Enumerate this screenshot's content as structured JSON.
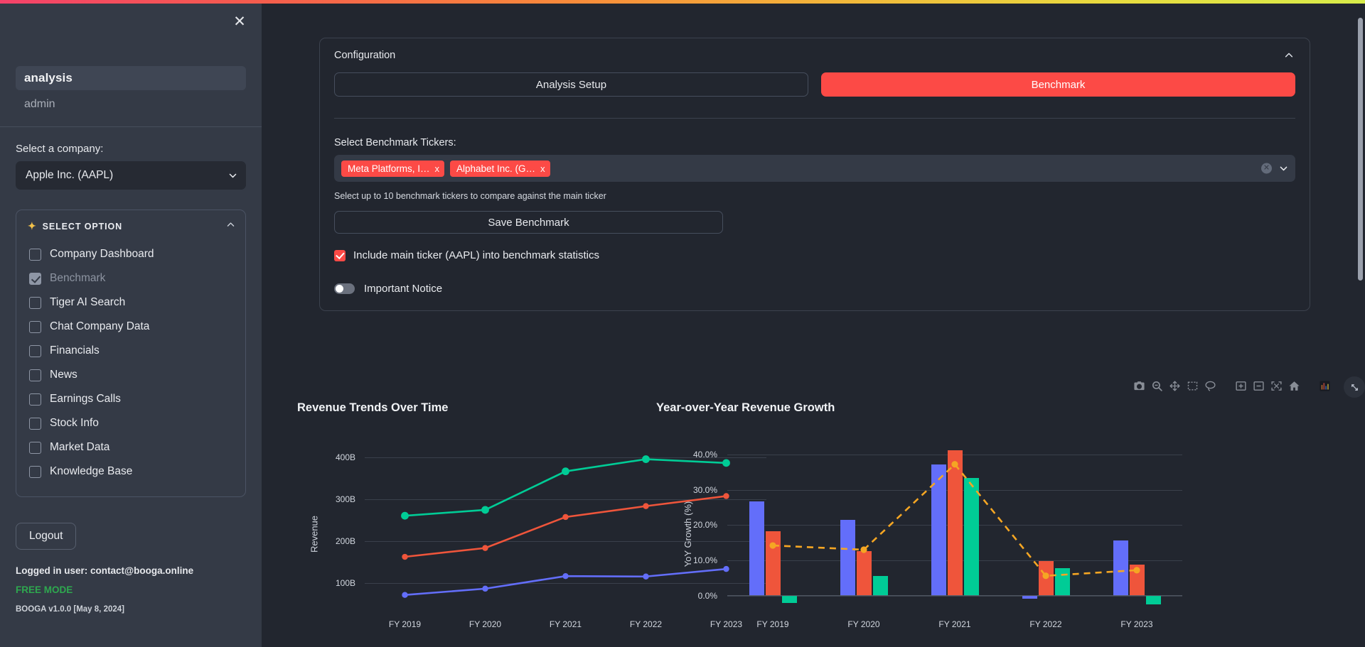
{
  "sidebar": {
    "close_icon": "close-icon",
    "app_name": "analysis",
    "user_role": "admin",
    "company_label": "Select a company:",
    "company_value": "Apple Inc. (AAPL)",
    "options_header": "SELECT OPTION",
    "options_header_icon": "sparkles-icon",
    "options": [
      {
        "label": "Company Dashboard",
        "checked": false,
        "disabled": false
      },
      {
        "label": "Benchmark",
        "checked": true,
        "disabled": true
      },
      {
        "label": "Tiger AI Search",
        "checked": false,
        "disabled": false
      },
      {
        "label": "Chat Company Data",
        "checked": false,
        "disabled": false
      },
      {
        "label": "Financials",
        "checked": false,
        "disabled": false
      },
      {
        "label": "News",
        "checked": false,
        "disabled": false
      },
      {
        "label": "Earnings Calls",
        "checked": false,
        "disabled": false
      },
      {
        "label": "Stock Info",
        "checked": false,
        "disabled": false
      },
      {
        "label": "Market Data",
        "checked": false,
        "disabled": false
      },
      {
        "label": "Knowledge Base",
        "checked": false,
        "disabled": false
      }
    ],
    "logout_label": "Logout",
    "logged_in_user": "Logged in user: contact@booga.online",
    "mode": "FREE MODE",
    "version": "BOOGA v1.0.0 [May 8, 2024]"
  },
  "config": {
    "title": "Configuration",
    "collapse_icon": "chevron-up-icon",
    "tabs": [
      {
        "label": "Analysis Setup",
        "active": false
      },
      {
        "label": "Benchmark",
        "active": true
      }
    ],
    "benchmark_label": "Select Benchmark Tickers:",
    "chips": [
      {
        "label": "Meta Platforms, I…",
        "remove": "x"
      },
      {
        "label": "Alphabet Inc. (G…",
        "remove": "x"
      }
    ],
    "clear_all_icon": "clear-all-icon",
    "dropdown_icon": "chevron-down-icon",
    "help_text": "Select up to 10 benchmark tickers to compare against the main ticker",
    "save_label": "Save Benchmark",
    "include_main_ticker_label": "Include main ticker (AAPL) into benchmark statistics",
    "include_main_ticker_checked": true,
    "notice_label": "Important Notice",
    "notice_on": false
  },
  "modebar": {
    "icons": [
      "camera-icon",
      "zoom-icon",
      "pan-icon",
      "box-select-icon",
      "lasso-select-icon",
      "zoom-in-icon",
      "zoom-out-icon",
      "autoscale-icon",
      "home-reset-icon",
      "plotly-logo-icon"
    ],
    "expand_icon": "expand-fullscreen-icon"
  },
  "colors": {
    "accent_red": "#fc4a46",
    "series_blue": "#636efa",
    "series_red": "#ef553b",
    "series_green": "#00cc96",
    "series_orange": "#f5a623",
    "free_mode_green": "#2ea84f",
    "sidebar_bg": "#343a46",
    "main_bg": "#22262f"
  },
  "chart_data": [
    {
      "type": "line",
      "title": "Revenue Trends Over Time",
      "xlabel": "",
      "ylabel": "Revenue",
      "categories": [
        "FY 2019",
        "FY 2020",
        "FY 2021",
        "FY 2022",
        "FY 2023"
      ],
      "ytick_labels": [
        "100B",
        "200B",
        "300B",
        "400B"
      ],
      "ytick_values": [
        100,
        200,
        300,
        400
      ],
      "ylim": [
        40,
        440
      ],
      "grid": true,
      "legend": "none",
      "series": [
        {
          "name": "series-green",
          "color": "#00cc96",
          "values": [
            260,
            274,
            366,
            395,
            386
          ]
        },
        {
          "name": "series-red",
          "color": "#ef553b",
          "values": [
            162,
            183,
            257,
            283,
            307
          ]
        },
        {
          "name": "series-blue",
          "color": "#636efa",
          "values": [
            71,
            86,
            116,
            115,
            133
          ]
        }
      ]
    },
    {
      "type": "bar",
      "title": "Year-over-Year Revenue Growth",
      "xlabel": "",
      "ylabel": "YoY Growth (%)",
      "categories": [
        "FY 2019",
        "FY 2020",
        "FY 2021",
        "FY 2022",
        "FY 2023"
      ],
      "ytick_labels": [
        "0.0%",
        "10.0%",
        "20.0%",
        "30.0%",
        "40.0%"
      ],
      "ytick_values": [
        0,
        10,
        20,
        30,
        40
      ],
      "ylim": [
        -3.5,
        44
      ],
      "grid": true,
      "legend": "none",
      "series": [
        {
          "name": "series-blue",
          "color": "#636efa",
          "values": [
            26.7,
            21.5,
            37.2,
            -0.8,
            15.6
          ]
        },
        {
          "name": "series-red",
          "color": "#ef553b",
          "values": [
            18.3,
            12.7,
            41.2,
            9.8,
            8.8
          ]
        },
        {
          "name": "series-green",
          "color": "#00cc96",
          "values": [
            -2.0,
            5.5,
            33.3,
            7.8,
            -2.4
          ]
        }
      ],
      "overlay_line": {
        "name": "series-orange-dashed",
        "color": "#f5a623",
        "style": "dashed",
        "values": [
          14.2,
          13.0,
          37.2,
          5.6,
          7.2
        ]
      }
    }
  ]
}
